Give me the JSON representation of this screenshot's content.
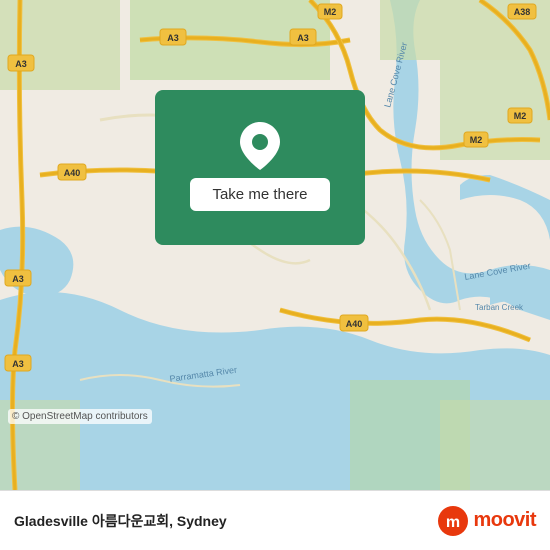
{
  "map": {
    "attribution": "© OpenStreetMap contributors",
    "background_color": "#e8e0d8"
  },
  "action_card": {
    "button_label": "Take me there",
    "background_color": "#2e8b5e"
  },
  "bottom_bar": {
    "place_name": "Gladesville 아름다운교회, Sydney",
    "moovit_label": "moovit"
  }
}
